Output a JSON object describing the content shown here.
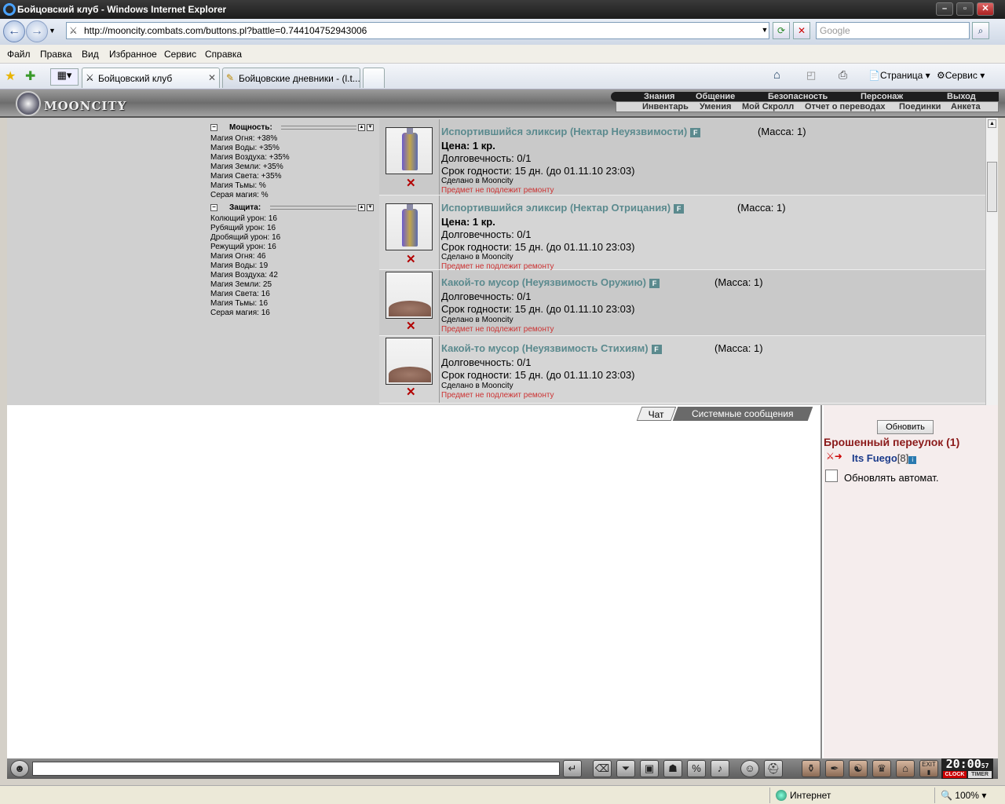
{
  "window": {
    "title": "Бойцовский клуб - Windows Internet Explorer"
  },
  "browser": {
    "url": "http://mooncity.combats.com/buttons.pl?battle=0.744104752943006",
    "search_placeholder": "Google",
    "menu": [
      "Файл",
      "Правка",
      "Вид",
      "Избранное",
      "Сервис",
      "Справка"
    ],
    "tabs": [
      "Бойцовский клуб",
      "Бойцовские дневники - (l.t..."
    ],
    "toolbar": {
      "page": "Страница",
      "service": "Сервис"
    }
  },
  "site": {
    "logo": "MOONCITY",
    "nav_top": [
      "Знания",
      "Общение",
      "Безопасность",
      "Персонаж",
      "Выход"
    ],
    "nav_bottom": [
      "Инвентарь",
      "Умения",
      "Мой Скролл",
      "Отчет о переводах",
      "Поединки",
      "Анкета"
    ]
  },
  "stats": {
    "power_title": "Мощность:",
    "power": [
      "Магия Огня: +38%",
      "Магия Воды: +35%",
      "Магия Воздуха: +35%",
      "Магия Земли: +35%",
      "Магия Света: +35%",
      "Магия Тьмы: %",
      "Серая магия: %"
    ],
    "defense_title": "Защита:",
    "defense": [
      "Колющий урон: 16",
      "Рубящий урон: 16",
      "Дробящий урон: 16",
      "Режущий урон: 16",
      "Магия Огня: 46",
      "Магия Воды: 19",
      "Магия Воздуха: 42",
      "Магия Земли: 25",
      "Магия Света: 16",
      "Магия Тьмы: 16",
      "Серая магия: 16"
    ]
  },
  "items": [
    {
      "name": "Испортившийся эликсир (Нектар Неуязвимости)",
      "mass": "(Масса: 1)",
      "price": "Цена: 1 кр.",
      "durability": "Долговечность: 0/1",
      "expiry": "Срок годности: 15 дн. (до 01.11.10 23:03)",
      "made": "Сделано в Mooncity",
      "repair": "Предмет не подлежит ремонту",
      "badge": "F"
    },
    {
      "name": "Испортившийся эликсир (Нектар Отрицания)",
      "mass": "(Масса: 1)",
      "price": "Цена: 1 кр.",
      "durability": "Долговечность: 0/1",
      "expiry": "Срок годности: 15 дн. (до 01.11.10 23:03)",
      "made": "Сделано в Mooncity",
      "repair": "Предмет не подлежит ремонту",
      "badge": "F"
    },
    {
      "name": "Какой-то мусор (Неуязвимость Оружию)",
      "mass": "(Масса: 1)",
      "durability": "Долговечность: 0/1",
      "expiry": "Срок годности: 15 дн. (до 01.11.10 23:03)",
      "made": "Сделано в Mooncity",
      "repair": "Предмет не подлежит ремонту",
      "badge": "F"
    },
    {
      "name": "Какой-то мусор (Неуязвимость Стихиям)",
      "mass": "(Масса: 1)",
      "durability": "Долговечность: 0/1",
      "expiry": "Срок годности: 15 дн. (до 01.11.10 23:03)",
      "made": "Сделано в Mooncity",
      "repair": "Предмет не подлежит ремонту",
      "badge": "F"
    }
  ],
  "chat": {
    "tab_chat": "Чат",
    "tab_system": "Системные сообщения"
  },
  "side": {
    "refresh": "Обновить",
    "location": "Брошенный переулок (1)",
    "player_name": "Its Fuego",
    "player_level": "[8]",
    "auto_refresh": "Обновлять автомат."
  },
  "clock": {
    "time": "20:00",
    "sec": "57",
    "clock_label": "CLOCK",
    "timer_label": "TIMER"
  },
  "status": {
    "zone": "Интернет",
    "zoom": "100%"
  }
}
